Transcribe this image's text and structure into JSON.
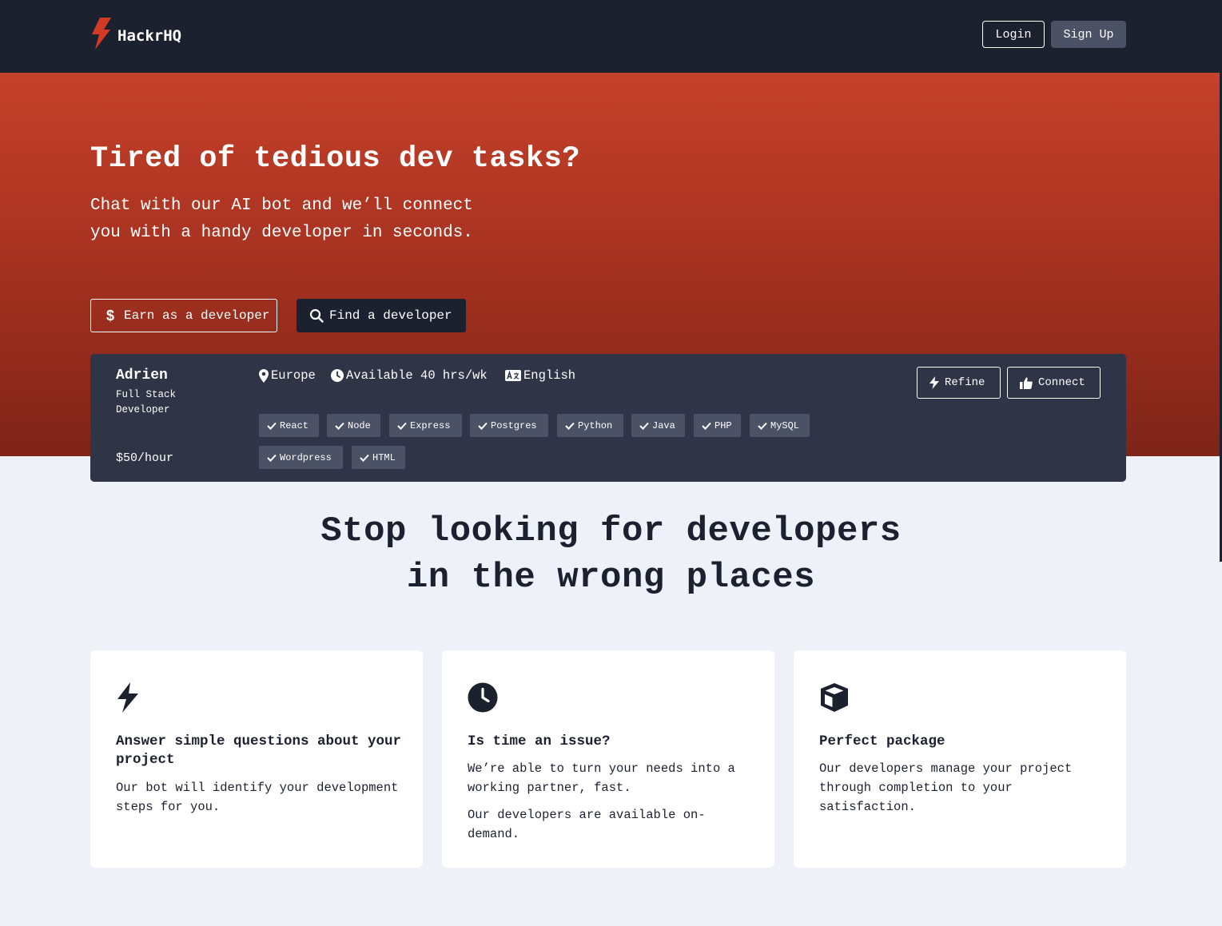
{
  "nav": {
    "brand": "HackrHQ",
    "login_label": "Login",
    "signup_label": "Sign Up"
  },
  "hero": {
    "title": "Tired of tedious dev tasks?",
    "subtitle": "Chat with our AI bot and we’ll connect you with a handy developer in seconds.",
    "earn_label": "Earn as a developer",
    "find_label": "Find a developer"
  },
  "developer": {
    "name": "Adrien",
    "role": "Full Stack Developer",
    "rate": "$50/hour",
    "location": "Europe",
    "availability": "Available 40 hrs/wk",
    "language": "English",
    "skills": [
      "React",
      "Node",
      "Express",
      "Postgres",
      "Python",
      "Java",
      "PHP",
      "MySQL",
      "Wordpress",
      "HTML"
    ],
    "refine_label": "Refine",
    "connect_label": "Connect"
  },
  "section": {
    "title_line1": "Stop looking for developers",
    "title_line2": "in the wrong places"
  },
  "features": [
    {
      "icon": "bolt-icon",
      "title": "Answer simple questions about your project",
      "paragraphs": [
        "Our bot will identify your development steps for you."
      ]
    },
    {
      "icon": "clock-icon",
      "title": "Is time an issue?",
      "paragraphs": [
        "We’re able to turn your needs into a working partner, fast.",
        "Our developers are available on-demand."
      ]
    },
    {
      "icon": "cube-icon",
      "title": "Perfect package",
      "paragraphs": [
        "Our developers manage your project through completion to your satisfaction."
      ]
    }
  ],
  "colors": {
    "nav_bg": "#1c2130",
    "hero_top": "#c5412a",
    "hero_bottom": "#7e2418",
    "card_bg": "#2f3547",
    "tag_bg": "#4b5266",
    "page_bg": "#eef1f7",
    "brand_accent": "#d23a26"
  }
}
